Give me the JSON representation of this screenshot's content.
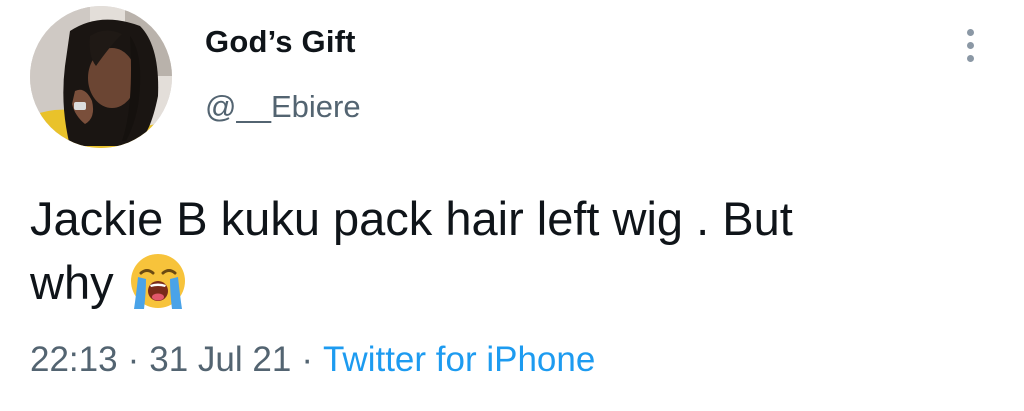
{
  "author": {
    "display_name": "God’s Gift",
    "handle": "@__Ebiere"
  },
  "tweet": {
    "text_line1": "Jackie B kuku pack hair left wig . But",
    "text_line2": "why",
    "emoji": "loudly-crying-face-emoji"
  },
  "meta": {
    "time": "22:13",
    "separator": "·",
    "date": "31 Jul 21",
    "source": "Twitter for iPhone"
  },
  "icons": {
    "more": "more-vertical-icon"
  },
  "colors": {
    "text": "#0f1419",
    "secondary": "#536471",
    "link": "#1d9bf0"
  }
}
